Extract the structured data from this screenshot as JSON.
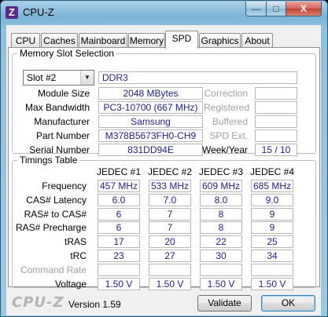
{
  "window": {
    "title": "CPU-Z",
    "icon_letter": "Z",
    "minimize": "—",
    "maximize": "□",
    "close": "X"
  },
  "tabs": [
    "CPU",
    "Caches",
    "Mainboard",
    "Memory",
    "SPD",
    "Graphics",
    "About"
  ],
  "active_tab": "SPD",
  "memory_slot": {
    "legend": "Memory Slot Selection",
    "slot_selected": "Slot #2",
    "type": "DDR3",
    "labels": {
      "module_size": "Module Size",
      "max_bandwidth": "Max Bandwidth",
      "manufacturer": "Manufacturer",
      "part_number": "Part Number",
      "serial_number": "Serial Number",
      "correction": "Correction",
      "registered": "Registered",
      "buffered": "Buffered",
      "spd_ext": "SPD Ext.",
      "week_year": "Week/Year"
    },
    "values": {
      "module_size": "2048 MBytes",
      "max_bandwidth": "PC3-10700 (667 MHz)",
      "manufacturer": "Samsung",
      "part_number": "M378B5673FH0-CH9",
      "serial_number": "831DD94E",
      "correction": "",
      "registered": "",
      "buffered": "",
      "spd_ext": "",
      "week_year": "15 / 10"
    }
  },
  "timings": {
    "legend": "Timings Table",
    "columns": [
      "JEDEC #1",
      "JEDEC #2",
      "JEDEC #3",
      "JEDEC #4"
    ],
    "rows": [
      {
        "label": "Frequency",
        "values": [
          "457 MHz",
          "533 MHz",
          "609 MHz",
          "685 MHz"
        ],
        "disabled": false
      },
      {
        "label": "CAS# Latency",
        "values": [
          "6.0",
          "7.0",
          "8.0",
          "9.0"
        ],
        "disabled": false
      },
      {
        "label": "RAS# to CAS#",
        "values": [
          "6",
          "7",
          "8",
          "9"
        ],
        "disabled": false
      },
      {
        "label": "RAS# Precharge",
        "values": [
          "6",
          "7",
          "8",
          "9"
        ],
        "disabled": false
      },
      {
        "label": "tRAS",
        "values": [
          "17",
          "20",
          "22",
          "25"
        ],
        "disabled": false
      },
      {
        "label": "tRC",
        "values": [
          "23",
          "27",
          "30",
          "34"
        ],
        "disabled": false
      },
      {
        "label": "Command Rate",
        "values": [
          "",
          "",
          "",
          ""
        ],
        "disabled": true
      },
      {
        "label": "Voltage",
        "values": [
          "1.50 V",
          "1.50 V",
          "1.50 V",
          "1.50 V"
        ],
        "disabled": false
      }
    ]
  },
  "footer": {
    "logo": "CPU-Z",
    "version": "Version 1.59",
    "validate": "Validate",
    "ok": "OK"
  }
}
